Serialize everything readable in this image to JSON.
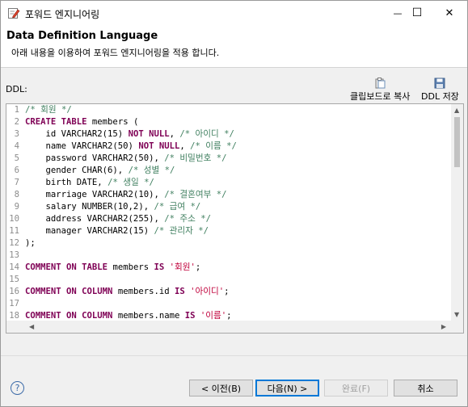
{
  "window": {
    "title": "포워드 엔지니어링",
    "minimize_glyph": "—",
    "maximize_glyph": "☐",
    "close_glyph": "✕"
  },
  "banner": {
    "title": "Data Definition Language",
    "description": "아래 내용을 이용하여 포워드 엔지니어링을 적용 합니다."
  },
  "ddl_label": "DDL:",
  "toolbar": {
    "copy_label": "클립보드로 복사",
    "copy_icon": "clipboard-icon",
    "save_label": "DDL 저장",
    "save_icon": "floppy-disk-icon"
  },
  "code_lines": [
    {
      "n": "1",
      "t": [
        [
          "cm",
          "/* 회원 */"
        ]
      ]
    },
    {
      "n": "2",
      "t": [
        [
          "kw",
          "CREATE TABLE"
        ],
        [
          "p",
          " members ("
        ]
      ]
    },
    {
      "n": "3",
      "t": [
        [
          "p",
          "    id VARCHAR2(15) "
        ],
        [
          "kw",
          "NOT NULL"
        ],
        [
          "p",
          ", "
        ],
        [
          "cm",
          "/* 아이디 */"
        ]
      ]
    },
    {
      "n": "4",
      "t": [
        [
          "p",
          "    name VARCHAR2(50) "
        ],
        [
          "kw",
          "NOT NULL"
        ],
        [
          "p",
          ", "
        ],
        [
          "cm",
          "/* 이름 */"
        ]
      ]
    },
    {
      "n": "5",
      "t": [
        [
          "p",
          "    password VARCHAR2(50), "
        ],
        [
          "cm",
          "/* 비밀번호 */"
        ]
      ]
    },
    {
      "n": "6",
      "t": [
        [
          "p",
          "    gender CHAR(6), "
        ],
        [
          "cm",
          "/* 성별 */"
        ]
      ]
    },
    {
      "n": "7",
      "t": [
        [
          "p",
          "    birth DATE, "
        ],
        [
          "cm",
          "/* 생일 */"
        ]
      ]
    },
    {
      "n": "8",
      "t": [
        [
          "p",
          "    marriage VARCHAR2(10), "
        ],
        [
          "cm",
          "/* 결혼여부 */"
        ]
      ]
    },
    {
      "n": "9",
      "t": [
        [
          "p",
          "    salary NUMBER(10,2), "
        ],
        [
          "cm",
          "/* 급여 */"
        ]
      ]
    },
    {
      "n": "10",
      "t": [
        [
          "p",
          "    address VARCHAR2(255), "
        ],
        [
          "cm",
          "/* 주소 */"
        ]
      ]
    },
    {
      "n": "11",
      "t": [
        [
          "p",
          "    manager VARCHAR2(15) "
        ],
        [
          "cm",
          "/* 관리자 */"
        ]
      ]
    },
    {
      "n": "12",
      "t": [
        [
          "p",
          ");"
        ]
      ]
    },
    {
      "n": "13",
      "t": []
    },
    {
      "n": "14",
      "t": [
        [
          "kw",
          "COMMENT ON TABLE"
        ],
        [
          "p",
          " members "
        ],
        [
          "kw",
          "IS"
        ],
        [
          "p",
          " "
        ],
        [
          "str",
          "'회원'"
        ],
        [
          "p",
          ";"
        ]
      ]
    },
    {
      "n": "15",
      "t": []
    },
    {
      "n": "16",
      "t": [
        [
          "kw",
          "COMMENT ON COLUMN"
        ],
        [
          "p",
          " members.id "
        ],
        [
          "kw",
          "IS"
        ],
        [
          "p",
          " "
        ],
        [
          "str",
          "'아이디'"
        ],
        [
          "p",
          ";"
        ]
      ]
    },
    {
      "n": "17",
      "t": []
    },
    {
      "n": "18",
      "t": [
        [
          "kw",
          "COMMENT ON COLUMN"
        ],
        [
          "p",
          " members.name "
        ],
        [
          "kw",
          "IS"
        ],
        [
          "p",
          " "
        ],
        [
          "str",
          "'이름'"
        ],
        [
          "p",
          ";"
        ]
      ]
    }
  ],
  "footer": {
    "help_glyph": "?",
    "back_label": "< 이전(B)",
    "next_label": "다음(N) >",
    "finish_label": "완료(F)",
    "cancel_label": "취소"
  },
  "colors": {
    "keyword": "#7f0055",
    "comment": "#3f7f5f",
    "string": "#c0003b",
    "default_button_border": "#0078d7"
  }
}
